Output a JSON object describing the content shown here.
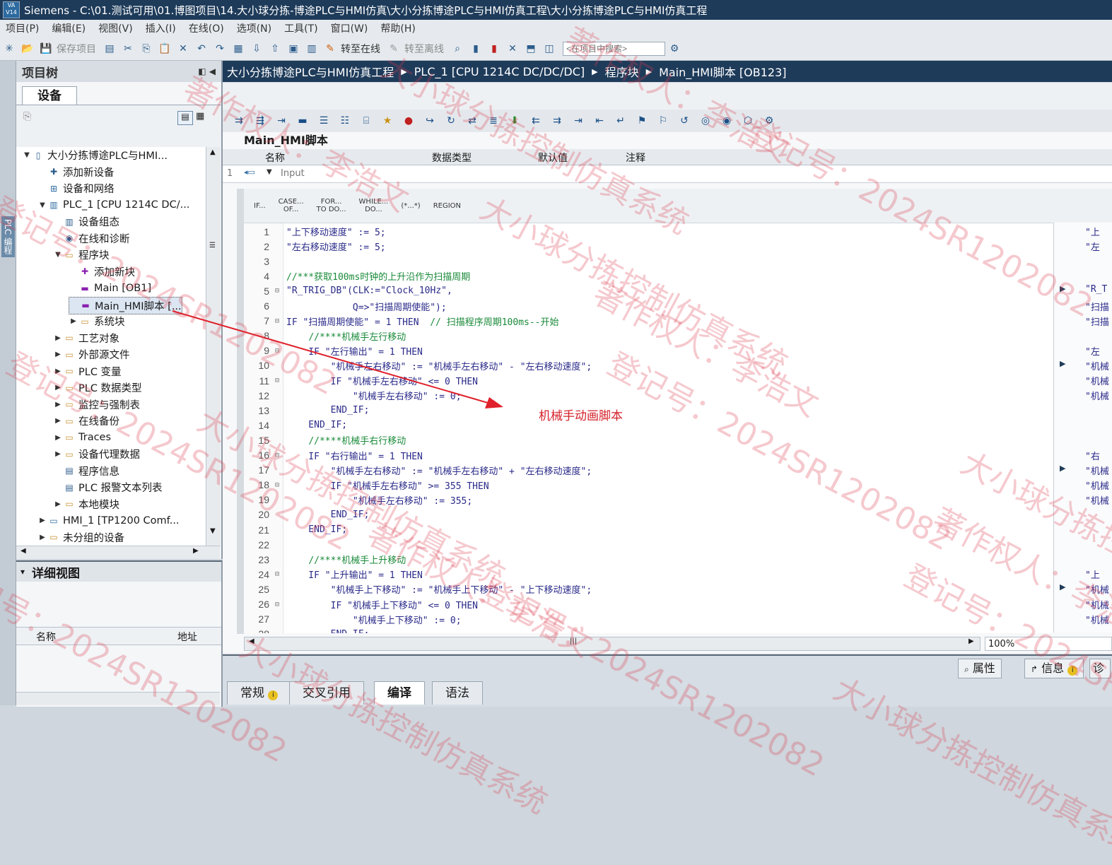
{
  "window": {
    "title": "Siemens  -  C:\\01.测试可用\\01.博图项目\\14.大小球分拣-博途PLC与HMI仿真\\大小分拣博途PLC与HMI仿真工程\\大小分拣博途PLC与HMI仿真工程",
    "logo_text": "VA V14"
  },
  "menu": [
    "项目(P)",
    "编辑(E)",
    "视图(V)",
    "插入(I)",
    "在线(O)",
    "选项(N)",
    "工具(T)",
    "窗口(W)",
    "帮助(H)"
  ],
  "toolbar": {
    "save_project": "保存项目",
    "go_online": "转至在线",
    "go_offline": "转至离线",
    "search_placeholder": "<在项目中搜索>"
  },
  "left_strip": {
    "label": "PLC 编程"
  },
  "project_tree": {
    "title": "项目树",
    "devices_tab": "设备",
    "items": [
      {
        "label": "大小分拣博途PLC与HMI...",
        "icon": "project-icon",
        "toggle": "▼"
      },
      {
        "label": "添加新设备",
        "icon": "add-device-icon",
        "toggle": ""
      },
      {
        "label": "设备和网络",
        "icon": "network-icon",
        "toggle": ""
      },
      {
        "label": "PLC_1 [CPU 1214C DC/...",
        "icon": "plc-icon",
        "toggle": "▼"
      },
      {
        "label": "设备组态",
        "icon": "device-config-icon",
        "toggle": ""
      },
      {
        "label": "在线和诊断",
        "icon": "diagnostics-icon",
        "toggle": ""
      },
      {
        "label": "程序块",
        "icon": "folder-icon",
        "toggle": "▼"
      },
      {
        "label": "添加新块",
        "icon": "add-block-icon",
        "toggle": ""
      },
      {
        "label": "Main [OB1]",
        "icon": "ob-block-icon",
        "toggle": ""
      },
      {
        "label": "Main_HMI脚本 [...",
        "icon": "ob-block-icon",
        "toggle": ""
      },
      {
        "label": "系统块",
        "icon": "folder-icon",
        "toggle": "▶"
      },
      {
        "label": "工艺对象",
        "icon": "folder-icon",
        "toggle": "▶"
      },
      {
        "label": "外部源文件",
        "icon": "folder-icon",
        "toggle": "▶"
      },
      {
        "label": "PLC 变量",
        "icon": "folder-icon",
        "toggle": "▶"
      },
      {
        "label": "PLC 数据类型",
        "icon": "folder-icon",
        "toggle": "▶"
      },
      {
        "label": "监控与强制表",
        "icon": "folder-icon",
        "toggle": "▶"
      },
      {
        "label": "在线备份",
        "icon": "folder-icon",
        "toggle": "▶"
      },
      {
        "label": "Traces",
        "icon": "folder-icon",
        "toggle": "▶"
      },
      {
        "label": "设备代理数据",
        "icon": "folder-icon",
        "toggle": "▶"
      },
      {
        "label": "程序信息",
        "icon": "info-icon",
        "toggle": ""
      },
      {
        "label": "PLC 报警文本列表",
        "icon": "list-icon",
        "toggle": ""
      },
      {
        "label": "本地模块",
        "icon": "folder-icon",
        "toggle": "▶"
      },
      {
        "label": "HMI_1 [TP1200 Comf...",
        "icon": "hmi-icon",
        "toggle": "▶"
      },
      {
        "label": "未分组的设备",
        "icon": "folder-icon",
        "toggle": "▶"
      }
    ]
  },
  "detail_view": {
    "title": "详细视图",
    "col_name": "名称",
    "col_address": "地址"
  },
  "breadcrumb": [
    "大小分拣博途PLC与HMI仿真工程",
    "PLC_1 [CPU 1214C DC/DC/DC]",
    "程序块",
    "Main_HMI脚本 [OB123]"
  ],
  "editor": {
    "block_name": "Main_HMI脚本",
    "iface_cols": [
      "名称",
      "数据类型",
      "默认值",
      "注释"
    ],
    "iface_row": {
      "num": "1",
      "name": "Input"
    },
    "keywords": [
      {
        "l1": "IF...",
        "l2": ""
      },
      {
        "l1": "CASE...",
        "l2": "OF..."
      },
      {
        "l1": "FOR...",
        "l2": "TO DO..."
      },
      {
        "l1": "WHILE...",
        "l2": "DO..."
      },
      {
        "l1": "(*...*)",
        "l2": ""
      },
      {
        "l1": "REGION",
        "l2": ""
      }
    ],
    "code_lines": [
      {
        "n": "1",
        "f": "",
        "t": "\"上下移动速度\" := 5;",
        "c": ""
      },
      {
        "n": "2",
        "f": "",
        "t": "\"左右移动速度\" := 5;",
        "c": ""
      },
      {
        "n": "3",
        "f": "",
        "t": "",
        "c": ""
      },
      {
        "n": "4",
        "f": "",
        "t": "",
        "c": "//***获取100ms时钟的上升沿作为扫描周期"
      },
      {
        "n": "5",
        "f": "⊟",
        "t": "\"R_TRIG_DB\"(CLK:=\"Clock_10Hz\",",
        "c": ""
      },
      {
        "n": "6",
        "f": "",
        "t": "            Q=>\"扫描周期使能\");",
        "c": ""
      },
      {
        "n": "7",
        "f": "⊟",
        "t": "IF \"扫描周期使能\" = 1 THEN  ",
        "c": "// 扫描程序周期100ms--开始"
      },
      {
        "n": "8",
        "f": "",
        "t": "    ",
        "c": "//****机械手左行移动"
      },
      {
        "n": "9",
        "f": "⊟",
        "t": "    IF \"左行输出\" = 1 THEN",
        "c": ""
      },
      {
        "n": "10",
        "f": "",
        "t": "        \"机械手左右移动\" := \"机械手左右移动\" - \"左右移动速度\";",
        "c": ""
      },
      {
        "n": "11",
        "f": "⊟",
        "t": "        IF \"机械手左右移动\" <= 0 THEN",
        "c": ""
      },
      {
        "n": "12",
        "f": "",
        "t": "            \"机械手左右移动\" := 0;",
        "c": ""
      },
      {
        "n": "13",
        "f": "",
        "t": "        END_IF;",
        "c": ""
      },
      {
        "n": "14",
        "f": "",
        "t": "    END_IF;",
        "c": ""
      },
      {
        "n": "15",
        "f": "",
        "t": "    ",
        "c": "//****机械手右行移动"
      },
      {
        "n": "16",
        "f": "⊟",
        "t": "    IF \"右行输出\" = 1 THEN",
        "c": ""
      },
      {
        "n": "17",
        "f": "",
        "t": "        \"机械手左右移动\" := \"机械手左右移动\" + \"左右移动速度\";",
        "c": ""
      },
      {
        "n": "18",
        "f": "⊟",
        "t": "        IF \"机械手左右移动\" >= 355 THEN",
        "c": ""
      },
      {
        "n": "19",
        "f": "",
        "t": "            \"机械手左右移动\" := 355;",
        "c": ""
      },
      {
        "n": "20",
        "f": "",
        "t": "        END_IF;",
        "c": ""
      },
      {
        "n": "21",
        "f": "",
        "t": "    END_IF;",
        "c": ""
      },
      {
        "n": "22",
        "f": "",
        "t": "",
        "c": ""
      },
      {
        "n": "23",
        "f": "",
        "t": "    ",
        "c": "//****机械手上升移动"
      },
      {
        "n": "24",
        "f": "⊟",
        "t": "    IF \"上升输出\" = 1 THEN",
        "c": ""
      },
      {
        "n": "25",
        "f": "",
        "t": "        \"机械手上下移动\" := \"机械手上下移动\" - \"上下移动速度\";",
        "c": ""
      },
      {
        "n": "26",
        "f": "⊟",
        "t": "        IF \"机械手上下移动\" <= 0 THEN",
        "c": ""
      },
      {
        "n": "27",
        "f": "",
        "t": "            \"机械手上下移动\" := 0;",
        "c": ""
      },
      {
        "n": "28",
        "f": "",
        "t": "        END_IF;",
        "c": ""
      }
    ],
    "right_pane": [
      {
        "t": "\"上",
        "a": ""
      },
      {
        "t": "\"左",
        "a": ""
      },
      {
        "t": "",
        "a": ""
      },
      {
        "t": "",
        "a": ""
      },
      {
        "t": "\"R_T",
        "a": "▶"
      },
      {
        "t": "\"扫描",
        "a": ""
      },
      {
        "t": "\"扫描",
        "a": ""
      },
      {
        "t": "",
        "a": ""
      },
      {
        "t": "\"左",
        "a": ""
      },
      {
        "t": "\"机械",
        "a": "▶"
      },
      {
        "t": "\"机械",
        "a": ""
      },
      {
        "t": "\"机械",
        "a": ""
      },
      {
        "t": "",
        "a": ""
      },
      {
        "t": "",
        "a": ""
      },
      {
        "t": "",
        "a": ""
      },
      {
        "t": "\"右",
        "a": ""
      },
      {
        "t": "\"机械",
        "a": "▶"
      },
      {
        "t": "\"机械",
        "a": ""
      },
      {
        "t": "\"机械",
        "a": ""
      },
      {
        "t": "",
        "a": ""
      },
      {
        "t": "",
        "a": ""
      },
      {
        "t": "",
        "a": ""
      },
      {
        "t": "",
        "a": ""
      },
      {
        "t": "\"上",
        "a": ""
      },
      {
        "t": "\"机械",
        "a": "▶"
      },
      {
        "t": "\"机械",
        "a": ""
      },
      {
        "t": "\"机械",
        "a": ""
      }
    ],
    "zoom": "100%"
  },
  "inspector": {
    "right_tabs": [
      "属性",
      "信息",
      "诊"
    ],
    "bottom_tabs": [
      "常规",
      "交叉引用",
      "编译",
      "语法"
    ]
  },
  "annotation": {
    "text": "机械手动画脚本",
    "color": "#d4222a"
  },
  "watermark": {
    "lines": [
      "大小球分拣控制仿真系统",
      "著作权人：李浩文",
      "登记号：2024SR1202082"
    ]
  }
}
